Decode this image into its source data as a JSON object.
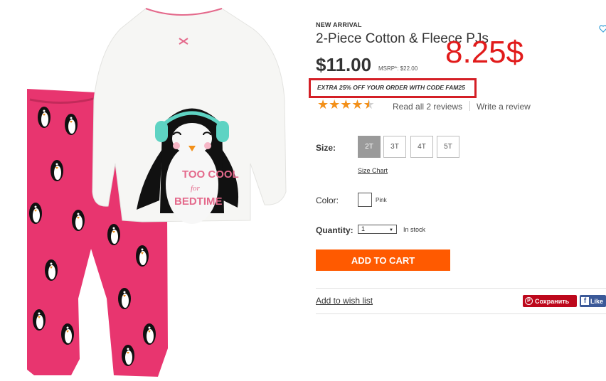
{
  "product": {
    "badge": "NEW ARRIVAL",
    "title": "2-Piece Cotton & Fleece PJs",
    "price": "$11.00",
    "msrp": "MSRP*: $22.00",
    "handwritten_price": "8.25$",
    "promo": "EXTRA 25% OFF YOUR ORDER WITH CODE FAM25",
    "rating": 4.5,
    "reviews_link": "Read all 2 reviews",
    "write_review": "Write a review",
    "image_text": {
      "line1": "TOO COOL",
      "line2": "for",
      "line3": "BEDTIME"
    }
  },
  "size": {
    "label": "Size:",
    "options": [
      "2T",
      "3T",
      "4T",
      "5T"
    ],
    "selected": "2T",
    "chart_link": "Size Chart"
  },
  "color": {
    "label": "Color:",
    "value": "Pink"
  },
  "quantity": {
    "label": "Quantity:",
    "value": "1",
    "stock": "In stock"
  },
  "actions": {
    "add_to_cart": "ADD TO CART",
    "wishlist": "Add to wish list",
    "pinterest": "Сохранить",
    "facebook": "Like"
  },
  "colors": {
    "accent_orange": "#ff5a00",
    "promo_red": "#d41f26",
    "star": "#f39019",
    "pants_pink": "#e8356f"
  }
}
